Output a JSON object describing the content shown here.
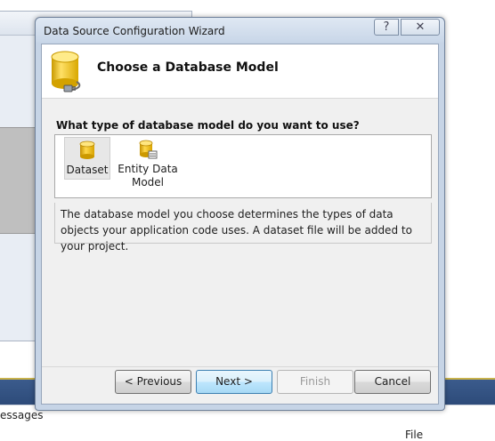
{
  "background": {
    "messages_text": "essages",
    "file_text": "File"
  },
  "dialog": {
    "title": "Data Source Configuration Wizard",
    "help_glyph": "?",
    "close_glyph": "✕",
    "header_title": "Choose a Database Model",
    "question": "What type of database model do you want to use?",
    "models": [
      {
        "label": "Dataset",
        "icon": "database-cylinder-icon",
        "selected": true
      },
      {
        "label": "Entity Data Model",
        "icon": "entity-model-icon",
        "selected": false
      }
    ],
    "description": "The database model you choose determines the types of data objects your application code uses. A dataset file will be added to your project.",
    "buttons": {
      "previous": "< Previous",
      "next": "Next >",
      "finish": "Finish",
      "cancel": "Cancel"
    }
  },
  "colors": {
    "cylinder_yellow": "#f2c318",
    "selection_bg": "#e7e7e7",
    "next_button_border": "#3c7fb1"
  }
}
